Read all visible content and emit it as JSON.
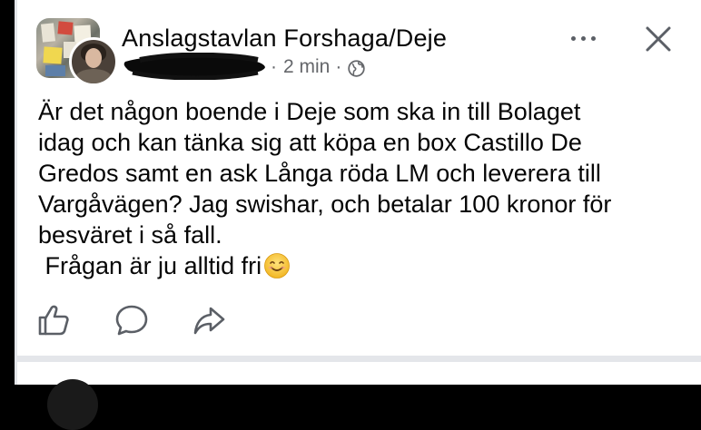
{
  "post": {
    "group_name": "Anslagstavlan Forshaga/Deje",
    "author_redacted": true,
    "separator": "·",
    "time": "2 min",
    "audience_icon": "globe-icon",
    "body_lines": [
      "Är det någon boende i Deje som ska in till Bolaget",
      "idag och kan tänka sig att köpa en box Castillo De",
      "Gredos samt en ask Långa röda LM och leverera till",
      "Vargåvägen? Jag swishar, och betalar 100 kronor för",
      "besväret i så fall."
    ],
    "last_line": " Frågan är ju alltid fri",
    "last_line_emoji": "smiling-face-icon"
  },
  "actions": {
    "icons": [
      "like-icon",
      "comment-icon",
      "share-icon"
    ]
  },
  "colors": {
    "text": "#050505",
    "meta": "#65676b",
    "icon": "#5b5f66",
    "emoji": "#f7c534",
    "divider": "#e4e6ea"
  }
}
